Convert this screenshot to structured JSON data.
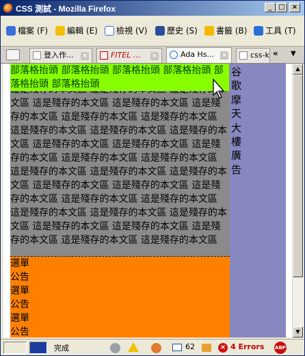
{
  "window": {
    "title": "CSS 測試 - Mozilla Firefox"
  },
  "menu": {
    "file": "檔案 (F)",
    "edit": "編輯 (E)",
    "view": "檢視 (V)",
    "history": "歷史 (S)",
    "bookmarks": "書籤 (B)",
    "tools": "工具 (T)"
  },
  "tabs": [
    {
      "label": "登入作..."
    },
    {
      "label": "FITEL ..."
    },
    {
      "label": "Ada Hs..."
    },
    {
      "label": "css-k"
    }
  ],
  "tab_nav": {
    "left": "«",
    "right": "»"
  },
  "page": {
    "header": "部落格抬頭 部落格抬頭 部落格抬頭 部落格抬頭 部落格抬頭 部落格抬頭",
    "sidebar": "谷歌摩天大樓廣告",
    "main": "這是殘存的本文區 這是殘存的本文區 這是殘存的本文區 這是殘存的本文區 這是殘存的本文區 這是殘存的本文區 這是殘存的本文區 這是殘存的本文區 這是殘存的本文區 這是殘存的本文區 這是殘存的本文區 這是殘存的本文區 這是殘存的本文區 這是殘存的本文區 這是殘存的本文區 這是殘存的本文區 這是殘存的本文區 這是殘存的本文區 這是殘存的本文區 這是殘存的本文區 這是殘存的本文區 這是殘存的本文區 這是殘存的本文區 這是殘存的本文區 這是殘存的本文區 這是殘存的本文區 這是殘存的本文區 這是殘存的本文區 這是殘存的本文區 這是殘存的本文區 這是殘存的本文區 這是殘存的本文區",
    "footer": [
      "選單",
      "公告",
      "選單",
      "公告",
      "選單",
      "公告"
    ]
  },
  "status": {
    "text": "完成",
    "count": "62",
    "errors": "4 Errors",
    "abp": "ABP"
  }
}
